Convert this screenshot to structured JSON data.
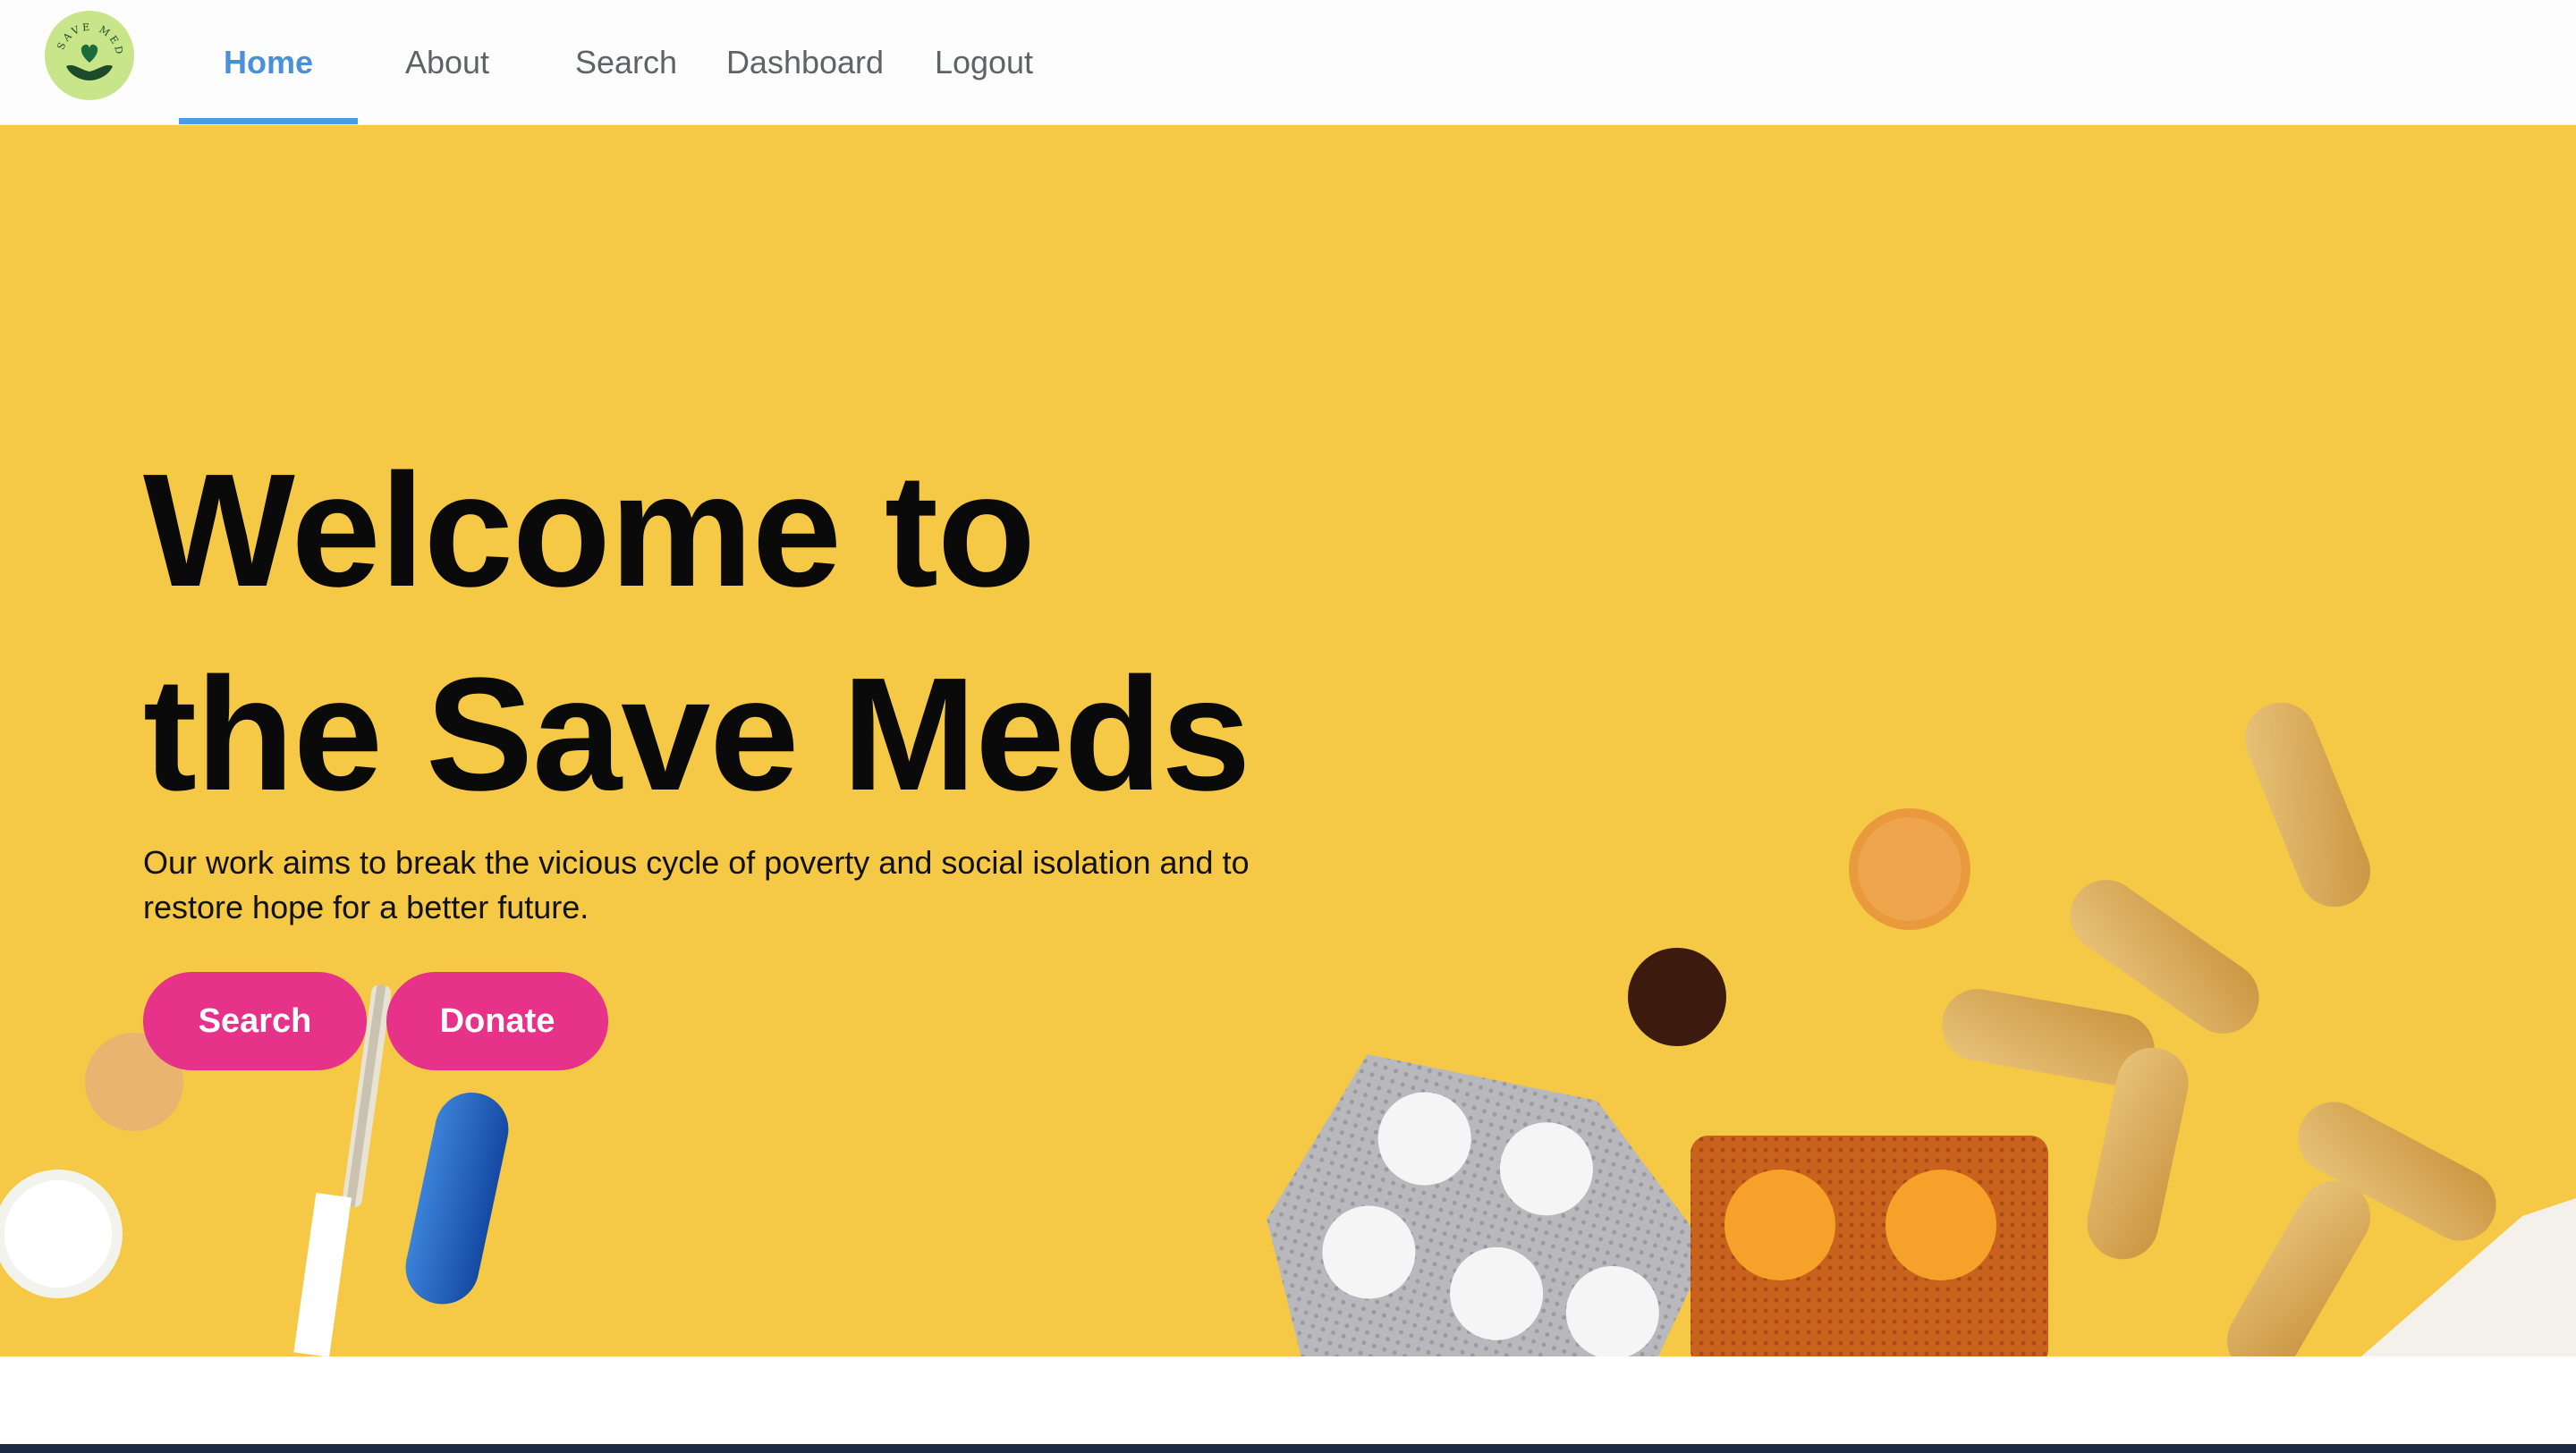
{
  "brand": {
    "logo_text": "SAVE MEDS",
    "logo_icon": "heart-hand-icon",
    "logo_bg_color": "#c9e58a"
  },
  "nav": {
    "items": [
      {
        "label": "Home",
        "active": true
      },
      {
        "label": "About",
        "active": false
      },
      {
        "label": "Search",
        "active": false
      },
      {
        "label": "Dashboard",
        "active": false
      },
      {
        "label": "Logout",
        "active": false
      }
    ],
    "active_color": "#4a90d9"
  },
  "hero": {
    "title_line1": "Welcome to",
    "title_line2": "the Save Meds",
    "subtitle": "Our work aims to break the vicious cycle of poverty and social isolation and to restore hope for a better future.",
    "buttons": {
      "search_label": "Search",
      "donate_label": "Donate"
    },
    "background_color": "#f5c845",
    "button_color": "#e63289"
  }
}
